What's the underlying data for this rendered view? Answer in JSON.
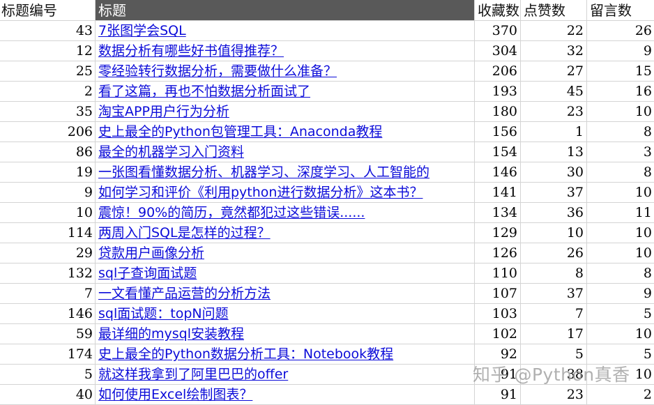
{
  "headers": {
    "id": "标题编号",
    "title": "标题",
    "favorites": "收藏数",
    "likes": "点赞数",
    "comments": "留言数"
  },
  "rows": [
    {
      "id": "43",
      "title": "7张图学会SQL",
      "favorites": "370",
      "likes": "22",
      "comments": "26"
    },
    {
      "id": "12",
      "title": "数据分析有哪些好书值得推荐？",
      "favorites": "304",
      "likes": "32",
      "comments": "9"
    },
    {
      "id": "25",
      "title": "零经验转行数据分析，需要做什么准备？",
      "favorites": "206",
      "likes": "27",
      "comments": "15"
    },
    {
      "id": "2",
      "title": "看了这篇，再也不怕数据分析面试了",
      "favorites": "193",
      "likes": "45",
      "comments": "16"
    },
    {
      "id": "35",
      "title": "淘宝APP用户行为分析",
      "favorites": "180",
      "likes": "23",
      "comments": "10"
    },
    {
      "id": "206",
      "title": "史上最全的Python包管理工具：Anaconda教程",
      "favorites": "156",
      "likes": "1",
      "comments": "8"
    },
    {
      "id": "86",
      "title": "最全的机器学习入门资料",
      "favorites": "154",
      "likes": "13",
      "comments": "3"
    },
    {
      "id": "19",
      "title": "一张图看懂数据分析、机器学习、深度学习、人工智能的",
      "favorites": "146",
      "likes": "30",
      "comments": "8"
    },
    {
      "id": "9",
      "title": "如何学习和评价《利用python进行数据分析》这本书？",
      "favorites": "141",
      "likes": "37",
      "comments": "10"
    },
    {
      "id": "10",
      "title": "震惊！90%的简历，竟然都犯过这些错误......",
      "favorites": "134",
      "likes": "36",
      "comments": "11"
    },
    {
      "id": "114",
      "title": "两周入门SQL是怎样的过程？",
      "favorites": "129",
      "likes": "10",
      "comments": "10"
    },
    {
      "id": "29",
      "title": "贷款用户画像分析",
      "favorites": "126",
      "likes": "26",
      "comments": "10"
    },
    {
      "id": "132",
      "title": "sql子查询面试题",
      "favorites": "110",
      "likes": "8",
      "comments": "8"
    },
    {
      "id": "7",
      "title": "一文看懂产品运营的分析方法",
      "favorites": "107",
      "likes": "37",
      "comments": "9"
    },
    {
      "id": "146",
      "title": "sql面试题：topN问题",
      "favorites": "103",
      "likes": "7",
      "comments": "5"
    },
    {
      "id": "59",
      "title": "最详细的mysql安装教程",
      "favorites": "102",
      "likes": "17",
      "comments": "10"
    },
    {
      "id": "174",
      "title": "史上最全的Python数据分析工具：Notebook教程",
      "favorites": "92",
      "likes": "5",
      "comments": "5"
    },
    {
      "id": "5",
      "title": "就这样我拿到了阿里巴巴的offer",
      "favorites": "91",
      "likes": "38",
      "comments": "10"
    },
    {
      "id": "40",
      "title": "如何使用Excel绘制图表？",
      "favorites": "91",
      "likes": "23",
      "comments": "2"
    }
  ],
  "watermark": "知乎 @Python真香"
}
